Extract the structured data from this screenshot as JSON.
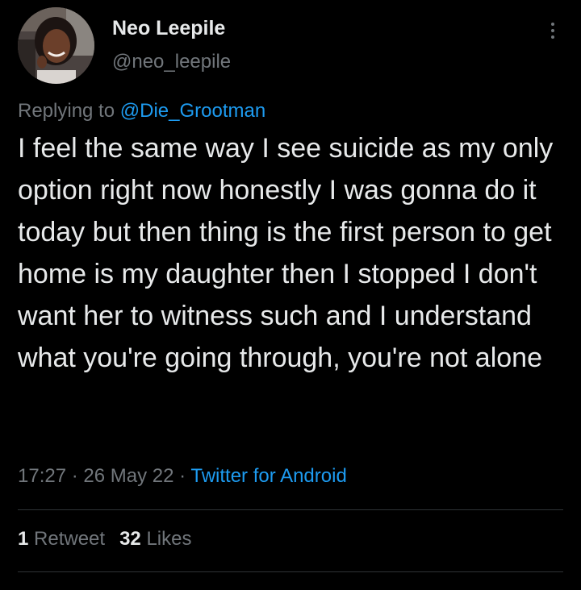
{
  "author": {
    "display_name": "Neo Leepile",
    "handle": "@neo_leepile"
  },
  "reply": {
    "prefix": "Replying to ",
    "mention": "@Die_Grootman"
  },
  "tweet": {
    "text": "I feel the same way I see suicide as my only option right now honestly I was gonna do it today but then thing is the first person to get home is my daughter then I stopped I don't want her to witness such and I understand what you're going through, you're not alone",
    "time": "17:27",
    "separator": " · ",
    "date": "26 May 22",
    "source": "Twitter for Android"
  },
  "stats": {
    "retweets_count": "1",
    "retweets_label": "Retweet",
    "likes_count": "32",
    "likes_label": "Likes"
  },
  "icons": {
    "more": "more-vertical-icon",
    "avatar": "profile-photo"
  },
  "colors": {
    "background": "#000000",
    "primary_text": "#e7e9ea",
    "secondary_text": "#71767b",
    "accent": "#1d9bf0",
    "divider": "#2f3336"
  }
}
